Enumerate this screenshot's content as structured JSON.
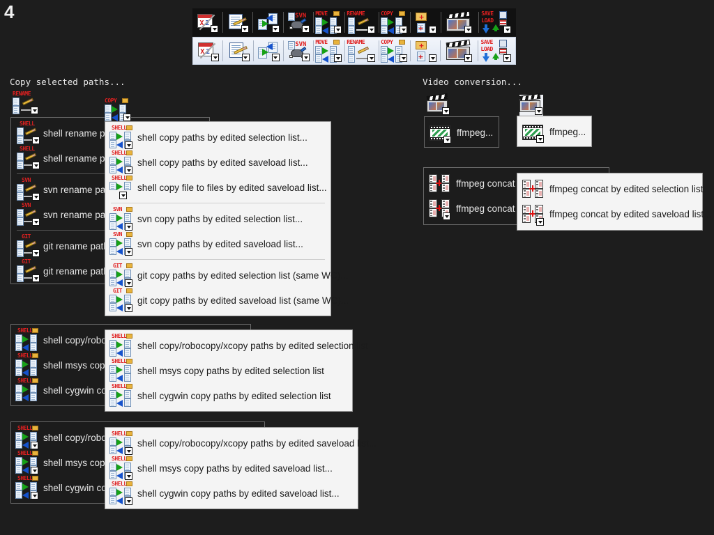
{
  "page": {
    "number": "4",
    "background_color": "#1d1d1d"
  },
  "sections": {
    "copy_selected_paths": "Copy selected paths...",
    "video_conversion": "Video conversion..."
  },
  "toolbar": {
    "rows": [
      {
        "name": "toolbar-row-dark",
        "state": "normal"
      },
      {
        "name": "toolbar-row-hover",
        "state": "highlighted"
      }
    ],
    "buttons": [
      {
        "name": "excel-to-text-button",
        "icon": "calendar-x2-icon",
        "label": "X2",
        "has_dropdown": true
      },
      {
        "name": "edit-note-button",
        "icon": "note-pencil-icon",
        "label": "",
        "has_dropdown": true
      },
      {
        "name": "move-copy-paths-button",
        "icon": "doc-arrows-icon",
        "label": "",
        "has_dropdown": true
      },
      {
        "name": "svn-button",
        "icon": "svn-turtle-icon",
        "label": "SVN",
        "has_dropdown": true
      },
      {
        "name": "move-button",
        "icon": "move-icon",
        "label": "MOVE",
        "has_dropdown": true
      },
      {
        "name": "rename-button",
        "icon": "rename-icon",
        "label": "RENAME",
        "has_dropdown": true
      },
      {
        "name": "copy-button",
        "icon": "copy-icon",
        "label": "COPY",
        "has_dropdown": true
      },
      {
        "name": "new-folder-file-button",
        "icon": "new-folder-icon",
        "label": "",
        "has_dropdown": true
      },
      {
        "name": "video-button",
        "icon": "clapperboard-icon",
        "label": "",
        "has_dropdown": true
      },
      {
        "name": "save-load-button",
        "icon": "save-load-icon",
        "label": "SAVE LOAD",
        "has_dropdown": true
      }
    ]
  },
  "menus": {
    "rename_menu": {
      "name": "rename-paths-menu",
      "theme": "dark",
      "trigger_icon": {
        "tag": "RENAME",
        "name": "rename-menu-trigger"
      },
      "groups": [
        {
          "items": [
            {
              "tag": "SHELL",
              "label": "shell rename pat",
              "icon": "rename-icon",
              "has_dropdown": true
            },
            {
              "tag": "SHELL",
              "label": "shell rename pat",
              "icon": "rename-icon",
              "has_dropdown": true
            }
          ]
        },
        {
          "items": [
            {
              "tag": "SVN",
              "label": "svn rename path",
              "icon": "rename-icon",
              "has_dropdown": true
            },
            {
              "tag": "SVN",
              "label": "svn rename path",
              "icon": "rename-icon",
              "has_dropdown": true
            }
          ]
        },
        {
          "items": [
            {
              "tag": "GIT",
              "label": "git rename paths",
              "icon": "rename-icon",
              "has_dropdown": true
            },
            {
              "tag": "GIT",
              "label": "git rename paths",
              "icon": "rename-icon",
              "has_dropdown": true
            }
          ]
        }
      ]
    },
    "copy_menu": {
      "name": "copy-paths-menu",
      "theme": "light",
      "trigger_icon": {
        "tag": "COPY",
        "name": "copy-menu-trigger"
      },
      "groups": [
        {
          "items": [
            {
              "tag": "SHELL",
              "label": "shell copy paths by edited selection list...",
              "icon": "copy-icon",
              "has_dropdown": true
            },
            {
              "tag": "SHELL",
              "label": "shell copy paths by edited saveload list...",
              "icon": "copy-icon",
              "has_dropdown": true
            },
            {
              "tag": "SHELL",
              "label": "shell copy file to files by edited saveload list...",
              "icon": "copy-single-icon",
              "has_dropdown": true
            }
          ]
        },
        {
          "items": [
            {
              "tag": "SVN",
              "label": "svn copy paths by edited selection list...",
              "icon": "copy-icon",
              "has_dropdown": true
            },
            {
              "tag": "SVN",
              "label": "svn copy paths by edited saveload list...",
              "icon": "copy-icon",
              "has_dropdown": true
            }
          ]
        },
        {
          "items": [
            {
              "tag": "GIT",
              "label": "git copy paths by edited selection list (same WC)...",
              "icon": "copy-icon",
              "has_dropdown": true
            },
            {
              "tag": "GIT",
              "label": "git copy paths by edited saveload list (same WC)...",
              "icon": "copy-icon",
              "has_dropdown": true
            }
          ]
        }
      ]
    },
    "shell_selection_back": {
      "name": "shell-copy-selection-menu-background",
      "theme": "dark",
      "items": [
        {
          "tag": "SHELL",
          "label": "shell copy/roboc",
          "icon": "copy-icon",
          "has_dropdown": false
        },
        {
          "tag": "SHELL",
          "label": "shell msys copy ",
          "icon": "copy-icon",
          "has_dropdown": false
        },
        {
          "tag": "SHELL",
          "label": "shell cygwin cop",
          "icon": "copy-icon",
          "has_dropdown": false
        }
      ]
    },
    "shell_selection_front": {
      "name": "shell-copy-selection-menu",
      "theme": "light",
      "items": [
        {
          "tag": "SHELL",
          "label": "shell copy/robocopy/xcopy paths by edited selection list",
          "icon": "copy-icon",
          "has_dropdown": false
        },
        {
          "tag": "SHELL",
          "label": "shell msys copy paths by edited selection list",
          "icon": "copy-icon",
          "has_dropdown": false
        },
        {
          "tag": "SHELL",
          "label": "shell cygwin copy paths by edited selection list",
          "icon": "copy-icon",
          "has_dropdown": false
        }
      ]
    },
    "shell_saveload_back": {
      "name": "shell-copy-saveload-menu-background",
      "theme": "dark",
      "items": [
        {
          "tag": "SHELL",
          "label": "shell copy/roboc",
          "icon": "copy-icon",
          "has_dropdown": true
        },
        {
          "tag": "SHELL",
          "label": "shell msys copy ",
          "icon": "copy-icon",
          "has_dropdown": true
        },
        {
          "tag": "SHELL",
          "label": "shell cygwin cop",
          "icon": "copy-icon",
          "has_dropdown": true
        }
      ]
    },
    "shell_saveload_front": {
      "name": "shell-copy-saveload-menu",
      "theme": "light",
      "items": [
        {
          "tag": "SHELL",
          "label": "shell copy/robocopy/xcopy paths by edited saveload list...",
          "icon": "copy-icon",
          "has_dropdown": true
        },
        {
          "tag": "SHELL",
          "label": "shell msys copy paths by edited saveload list...",
          "icon": "copy-icon",
          "has_dropdown": true
        },
        {
          "tag": "SHELL",
          "label": "shell cygwin copy paths by edited saveload list...",
          "icon": "copy-icon",
          "has_dropdown": true
        }
      ]
    },
    "ffmpeg_dark": {
      "name": "ffmpeg-menu-dark",
      "theme": "dark",
      "trigger_icon": {
        "name": "clapperboard-icon"
      },
      "items": [
        {
          "label": "ffmpeg...",
          "icon": "filmstrip-icon",
          "has_dropdown": true
        }
      ]
    },
    "ffmpeg_light": {
      "name": "ffmpeg-menu-light",
      "theme": "light",
      "trigger_icon": {
        "name": "clapperboard-icon"
      },
      "items": [
        {
          "label": "ffmpeg...",
          "icon": "filmstrip-icon",
          "has_dropdown": true
        }
      ]
    },
    "ffmpeg_concat_back": {
      "name": "ffmpeg-concat-menu-background",
      "theme": "dark",
      "items": [
        {
          "label": "ffmpeg concat b",
          "icon": "concat-icon",
          "has_dropdown": false
        },
        {
          "label": "ffmpeg concat b",
          "icon": "concat-icon",
          "has_dropdown": true
        }
      ]
    },
    "ffmpeg_concat_front": {
      "name": "ffmpeg-concat-menu",
      "theme": "light",
      "items": [
        {
          "label": "ffmpeg concat by edited selection list",
          "icon": "concat-icon",
          "has_dropdown": false
        },
        {
          "label": "ffmpeg concat by edited saveload list...",
          "icon": "concat-icon",
          "has_dropdown": true
        }
      ]
    }
  },
  "colors": {
    "background": "#1d1d1d",
    "dark_menu_bg": "#1c1c1c",
    "light_menu_bg": "#f4f4f4",
    "menu_border": "#6c6c6c",
    "tag_red": "#e02020",
    "arrow_green": "#17a117",
    "arrow_blue": "#1552cc"
  }
}
